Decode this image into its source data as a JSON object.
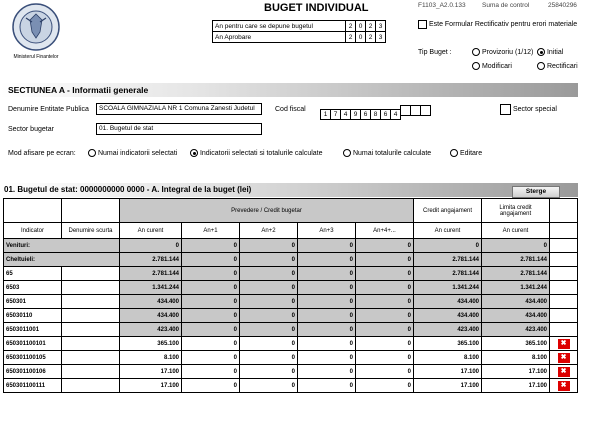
{
  "header": {
    "logo_caption": "Ministerul Finantelor",
    "title": "BUGET INDIVIDUAL",
    "form_code": "F1103_A2.0.133",
    "control_label": "Suma de control",
    "control_value": "25840296",
    "year_rows": [
      {
        "label": "An pentru care se depune bugetul",
        "digits": [
          "2",
          "0",
          "2",
          "3"
        ]
      },
      {
        "label": "An Aprobare",
        "digits": [
          "2",
          "0",
          "2",
          "3"
        ]
      }
    ],
    "rectificativ_label": "Este Formular Rectificativ pentru erori materiale",
    "tip_buget_label": "Tip Buget :",
    "tip_buget_options": [
      {
        "label": "Provizoriu (1/12)",
        "selected": false
      },
      {
        "label": "Initial",
        "selected": true
      },
      {
        "label": "Modificari",
        "selected": false
      },
      {
        "label": "Rectificari",
        "selected": false
      }
    ]
  },
  "section_a": {
    "title": "SECTIUNEA A - Informatii generale",
    "entity_label": "Denumire Entitate Publica",
    "entity_value": "SCOALA GIMNAZIALA NR 1 Comuna Zanesti Judetul",
    "cf_label": "Cod fiscal",
    "cf_digits": [
      "1",
      "7",
      "4",
      "9",
      "6",
      "8",
      "6",
      "4",
      "",
      "",
      ""
    ],
    "sector_special_label": "Sector special",
    "sector_label": "Sector bugetar",
    "sector_value": "01. Bugetul de stat",
    "mode_label": "Mod afisare pe ecran:",
    "mode_options": [
      {
        "label": "Numai indicatorii selectati",
        "selected": false
      },
      {
        "label": "Indicatorii selectati si totalurile calculate",
        "selected": true
      },
      {
        "label": "Numai totalurile calculate",
        "selected": false
      },
      {
        "label": "Editare",
        "selected": false
      }
    ]
  },
  "budget": {
    "title": "01. Bugetul de stat: 0000000000 0000 - A. Integral de la buget (lei)",
    "delete_label": "Sterge",
    "col_indicator": "Indicator",
    "col_short": "Denumire scurta",
    "col_prevedere": "Prevedere / Credit bugetar",
    "col_credit_ang": "Credit angajament",
    "col_limita": "Limita credit angajament",
    "sub_cols": [
      "An curent",
      "An+1",
      "An+2",
      "An+3",
      "An+4+...",
      "An curent",
      "An curent"
    ],
    "rows": [
      {
        "ind": "Venituri:",
        "name": "",
        "vals": [
          "0",
          "0",
          "0",
          "0",
          "0",
          "0",
          "0"
        ],
        "x": false
      },
      {
        "ind": "Cheltuieli:",
        "name": "",
        "vals": [
          "2.781.144",
          "0",
          "0",
          "0",
          "0",
          "2.781.144",
          "2.781.144"
        ],
        "x": false
      },
      {
        "ind": "65",
        "name": "",
        "vals": [
          "2.781.144",
          "0",
          "0",
          "0",
          "0",
          "2.781.144",
          "2.781.144"
        ],
        "x": false
      },
      {
        "ind": "6503",
        "name": "",
        "vals": [
          "1.341.244",
          "0",
          "0",
          "0",
          "0",
          "1.341.244",
          "1.341.244"
        ],
        "x": false
      },
      {
        "ind": "650301",
        "name": "",
        "vals": [
          "434.400",
          "0",
          "0",
          "0",
          "0",
          "434.400",
          "434.400"
        ],
        "x": false
      },
      {
        "ind": "65030110",
        "name": "",
        "vals": [
          "434.400",
          "0",
          "0",
          "0",
          "0",
          "434.400",
          "434.400"
        ],
        "x": false
      },
      {
        "ind": "6503011001",
        "name": "",
        "vals": [
          "423.400",
          "0",
          "0",
          "0",
          "0",
          "423.400",
          "423.400"
        ],
        "x": false
      },
      {
        "ind": "650301100101",
        "name": "",
        "vals": [
          "365.100",
          "0",
          "0",
          "0",
          "0",
          "365.100",
          "365.100"
        ],
        "x": true
      },
      {
        "ind": "650301100105",
        "name": "",
        "vals": [
          "8.100",
          "0",
          "0",
          "0",
          "0",
          "8.100",
          "8.100"
        ],
        "x": true
      },
      {
        "ind": "650301100106",
        "name": "",
        "vals": [
          "17.100",
          "0",
          "0",
          "0",
          "0",
          "17.100",
          "17.100"
        ],
        "x": true
      },
      {
        "ind": "650301100111",
        "name": "",
        "vals": [
          "17.100",
          "0",
          "0",
          "0",
          "0",
          "17.100",
          "17.100"
        ],
        "x": true
      }
    ]
  }
}
